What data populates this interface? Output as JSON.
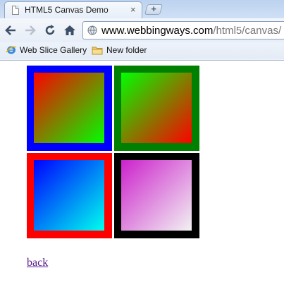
{
  "browser": {
    "tab_title": "HTML5 Canvas Demo",
    "tab_close_glyph": "×",
    "new_tab_glyph": "+",
    "url_host": "www.webbingways.com",
    "url_path": "/html5/canvas/",
    "icons": [
      "page-icon",
      "back-icon",
      "forward-icon",
      "reload-icon",
      "home-icon",
      "globe-icon",
      "ie-icon",
      "folder-icon"
    ]
  },
  "bookmarks": [
    {
      "label": "Web Slice Gallery",
      "icon": "ie-icon"
    },
    {
      "label": "New folder",
      "icon": "folder-icon"
    }
  ],
  "canvases": [
    {
      "border": "#0000ff",
      "gradient_from": "#ff0000",
      "gradient_to": "#00ff00",
      "direction": "top-left to bottom-right"
    },
    {
      "border": "#008000",
      "gradient_from": "#00ff00",
      "gradient_to": "#ff0000",
      "direction": "top-left to bottom-right"
    },
    {
      "border": "#ff0000",
      "gradient_from": "#0000ff",
      "gradient_to": "#00ffee",
      "direction": "top-left to bottom-right"
    },
    {
      "border": "#000000",
      "gradient_from": "#cc22cc",
      "gradient_to": "#f2f2f2",
      "direction": "top-left to bottom-right"
    }
  ],
  "page": {
    "back_label": "back"
  }
}
